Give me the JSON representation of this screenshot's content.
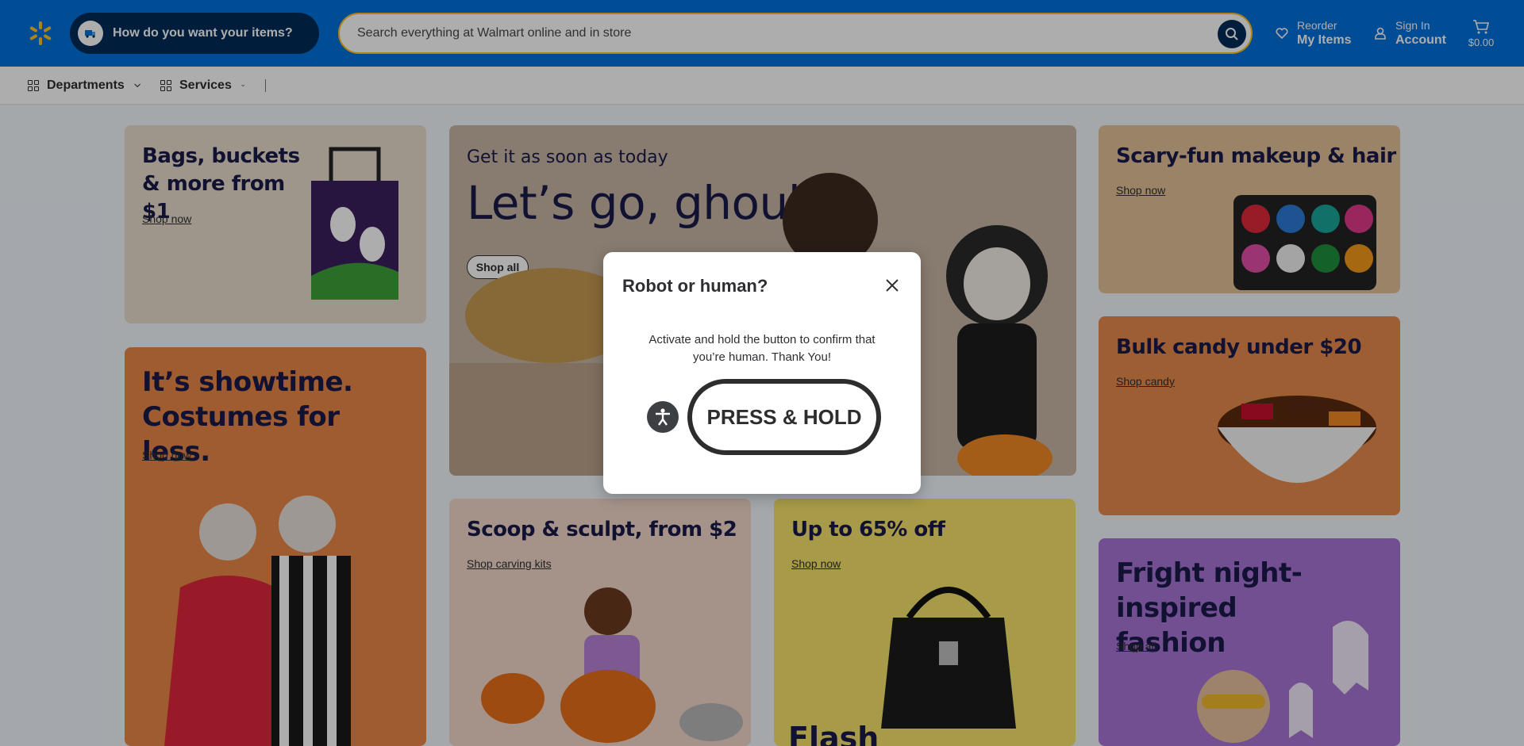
{
  "header": {
    "logo": "walmart-spark-icon",
    "delivery_label": "How do you want your items?",
    "search_placeholder": "Search everything at Walmart online and in store",
    "reorder_line1": "Reorder",
    "reorder_line2": "My Items",
    "signin_line1": "Sign In",
    "signin_line2": "Account",
    "cart_amount": "$0.00"
  },
  "subnav": {
    "departments": "Departments",
    "services": "Services"
  },
  "tiles": {
    "bags": {
      "title": "Bags, buckets & more from $1",
      "link": "Shop now"
    },
    "hero": {
      "eyebrow": "Get it as soon as today",
      "title": "Let’s go, ghouls",
      "button": "Shop all"
    },
    "makeup": {
      "title": "Scary-fun makeup & hair",
      "link": "Shop now"
    },
    "candy": {
      "title": "Bulk candy under $20",
      "link": "Shop candy"
    },
    "showtime": {
      "title": "It’s showtime. Costumes for less.",
      "link": "Shop now"
    },
    "scoop": {
      "title": "Scoop & sculpt, from $2",
      "link": "Shop carving kits"
    },
    "flash": {
      "title": "Up to 65% off",
      "link": "Shop now",
      "bottom_text": "Flash"
    },
    "fright": {
      "title": "Fright night-inspired fashion",
      "link": "Shop all"
    }
  },
  "dialog": {
    "title": "Robot or human?",
    "message": "Activate and hold the button to confirm that you’re human. Thank You!",
    "hold_button": "PRESS & HOLD"
  },
  "colors": {
    "brand_blue": "#0071dc",
    "spark_yellow": "#ffc220",
    "navy": "#002d58"
  }
}
